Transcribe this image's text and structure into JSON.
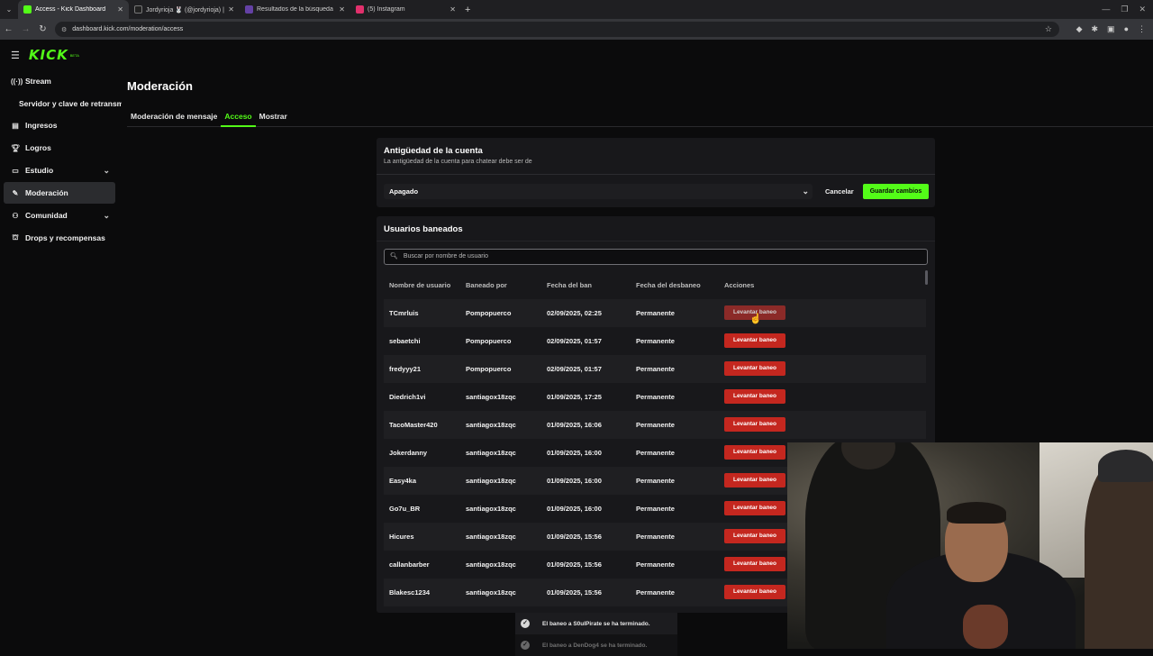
{
  "browser": {
    "tabs": [
      {
        "title": "Access - Kick Dashboard",
        "active": true,
        "color": "#53fc18"
      },
      {
        "title": "Jordyrioja 🐰 (@jordyrioja) | Ti...",
        "active": false,
        "color": "#222222"
      },
      {
        "title": "Resultados de la búsqueda de ...",
        "active": false,
        "color": "#6441a5"
      },
      {
        "title": "(5) Instagram",
        "active": false,
        "color": "#e1306c"
      }
    ],
    "url": "dashboard.kick.com/moderation/access"
  },
  "sidebar": {
    "logo": "KICK",
    "logo_beta": "BETA",
    "items": [
      {
        "label": "Stream",
        "icon": "broadcast-icon"
      },
      {
        "label": "Servidor y clave de retransmisión",
        "sub": true
      },
      {
        "label": "Ingresos",
        "icon": "wallet-icon"
      },
      {
        "label": "Logros",
        "icon": "trophy-icon"
      },
      {
        "label": "Estudio",
        "icon": "studio-icon",
        "expandable": true
      },
      {
        "label": "Moderación",
        "icon": "wrench-icon",
        "active": true
      },
      {
        "label": "Comunidad",
        "icon": "community-icon",
        "expandable": true
      },
      {
        "label": "Drops y recompensas",
        "icon": "gift-icon"
      }
    ]
  },
  "page": {
    "title": "Moderación",
    "tabs": [
      {
        "label": "Moderación de mensaje",
        "active": false
      },
      {
        "label": "Acceso",
        "active": true
      },
      {
        "label": "Mostrar",
        "active": false
      }
    ]
  },
  "account_age": {
    "title": "Antigüedad de la cuenta",
    "subtitle": "La antigüedad de la cuenta para chatear debe ser de",
    "select_value": "Apagado",
    "cancel_label": "Cancelar",
    "save_label": "Guardar cambios"
  },
  "banned": {
    "title": "Usuarios baneados",
    "search_placeholder": "Buscar por nombre de usuario",
    "columns": [
      "Nombre de usuario",
      "Baneado por",
      "Fecha del ban",
      "Fecha del desbaneo",
      "Acciones"
    ],
    "action_label": "Levantar baneo",
    "rows": [
      {
        "user": "TCmrluis",
        "by": "Pompopuerco",
        "date": "02/09/2025, 02:25",
        "unban": "Permanente"
      },
      {
        "user": "sebaetchi",
        "by": "Pompopuerco",
        "date": "02/09/2025, 01:57",
        "unban": "Permanente"
      },
      {
        "user": "fredyyy21",
        "by": "Pompopuerco",
        "date": "02/09/2025, 01:57",
        "unban": "Permanente"
      },
      {
        "user": "Diedrich1vi",
        "by": "santiagox18zqc",
        "date": "01/09/2025, 17:25",
        "unban": "Permanente"
      },
      {
        "user": "TacoMaster420",
        "by": "santiagox18zqc",
        "date": "01/09/2025, 16:06",
        "unban": "Permanente"
      },
      {
        "user": "Jokerdanny",
        "by": "santiagox18zqc",
        "date": "01/09/2025, 16:00",
        "unban": "Permanente"
      },
      {
        "user": "Easy4ka",
        "by": "santiagox18zqc",
        "date": "01/09/2025, 16:00",
        "unban": "Permanente"
      },
      {
        "user": "Go7u_BR",
        "by": "santiagox18zqc",
        "date": "01/09/2025, 16:00",
        "unban": "Permanente"
      },
      {
        "user": "Hicures",
        "by": "santiagox18zqc",
        "date": "01/09/2025, 15:56",
        "unban": "Permanente"
      },
      {
        "user": "callanbarber",
        "by": "santiagox18zqc",
        "date": "01/09/2025, 15:56",
        "unban": "Permanente"
      },
      {
        "user": "Blakesc1234",
        "by": "santiagox18zqc",
        "date": "01/09/2025, 15:56",
        "unban": "Permanente"
      }
    ]
  },
  "toasts": [
    {
      "text": "El baneo a S0ulPirate se ha terminado."
    },
    {
      "text": "El baneo a DenDog4 se ha terminado."
    }
  ],
  "colors": {
    "accent": "#53fc18",
    "danger": "#c4271f"
  }
}
